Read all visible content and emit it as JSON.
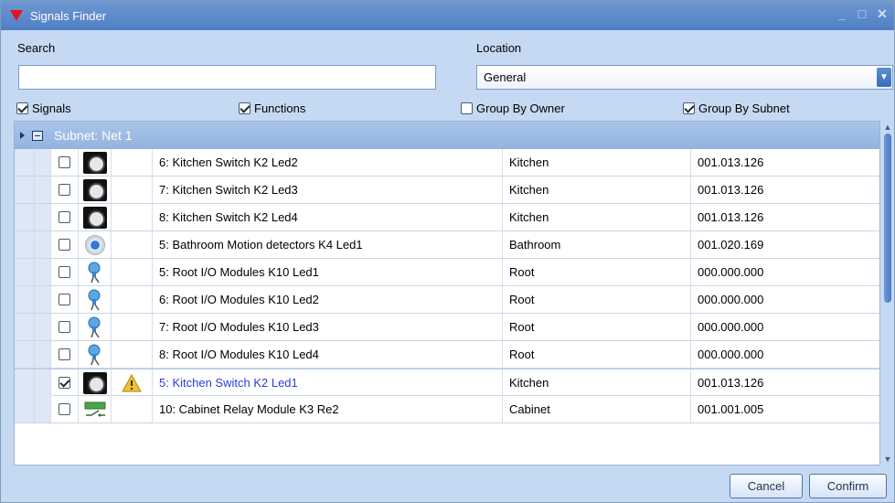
{
  "window": {
    "title": "Signals Finder",
    "logo_icon": "red-triangle-logo-icon",
    "minimize_icon": "minimize-icon",
    "maximize_icon": "maximize-icon",
    "close_icon": "close-icon"
  },
  "search": {
    "label": "Search",
    "value": "",
    "placeholder": ""
  },
  "location": {
    "label": "Location",
    "value": "General",
    "arrow_icon": "chevron-down-icon"
  },
  "filters": {
    "signals": {
      "label": "Signals",
      "checked": true
    },
    "functions": {
      "label": "Functions",
      "checked": true
    },
    "group_by_owner": {
      "label": "Group By Owner",
      "checked": false
    },
    "group_by_subnet": {
      "label": "Group By Subnet",
      "checked": true
    }
  },
  "group": {
    "label": "Subnet: Net 1"
  },
  "rows": [
    {
      "checked": false,
      "icon": "switch-icon",
      "warning": false,
      "name": "6: Kitchen Switch K2 Led2",
      "location": "Kitchen",
      "address": "001.013.126"
    },
    {
      "checked": false,
      "icon": "switch-icon",
      "warning": false,
      "name": "7: Kitchen Switch K2 Led3",
      "location": "Kitchen",
      "address": "001.013.126"
    },
    {
      "checked": false,
      "icon": "switch-icon",
      "warning": false,
      "name": "8: Kitchen Switch K2 Led4",
      "location": "Kitchen",
      "address": "001.013.126"
    },
    {
      "checked": false,
      "icon": "motion-detector-icon",
      "warning": false,
      "name": "5: Bathroom Motion detectors K4 Led1",
      "location": "Bathroom",
      "address": "001.020.169"
    },
    {
      "checked": false,
      "icon": "io-module-icon",
      "warning": false,
      "name": "5: Root I/O Modules K10 Led1",
      "location": "Root",
      "address": "000.000.000"
    },
    {
      "checked": false,
      "icon": "io-module-icon",
      "warning": false,
      "name": "6: Root I/O Modules K10 Led2",
      "location": "Root",
      "address": "000.000.000"
    },
    {
      "checked": false,
      "icon": "io-module-icon",
      "warning": false,
      "name": "7: Root I/O Modules K10 Led3",
      "location": "Root",
      "address": "000.000.000"
    },
    {
      "checked": false,
      "icon": "io-module-icon",
      "warning": false,
      "name": "8: Root I/O Modules K10 Led4",
      "location": "Root",
      "address": "000.000.000"
    },
    {
      "checked": true,
      "icon": "switch-icon",
      "warning": true,
      "name": "5: Kitchen Switch K2 Led1",
      "location": "Kitchen",
      "address": "001.013.126"
    },
    {
      "checked": false,
      "icon": "relay-icon",
      "warning": false,
      "name": "10: Cabinet Relay Module K3 Re2",
      "location": "Cabinet",
      "address": "001.001.005"
    }
  ],
  "colors": {
    "warning_name": "#2a3fd6",
    "title_bar": "#5a88cb",
    "group_header": "#9bb9e3"
  },
  "buttons": {
    "cancel": "Cancel",
    "confirm": "Confirm"
  }
}
